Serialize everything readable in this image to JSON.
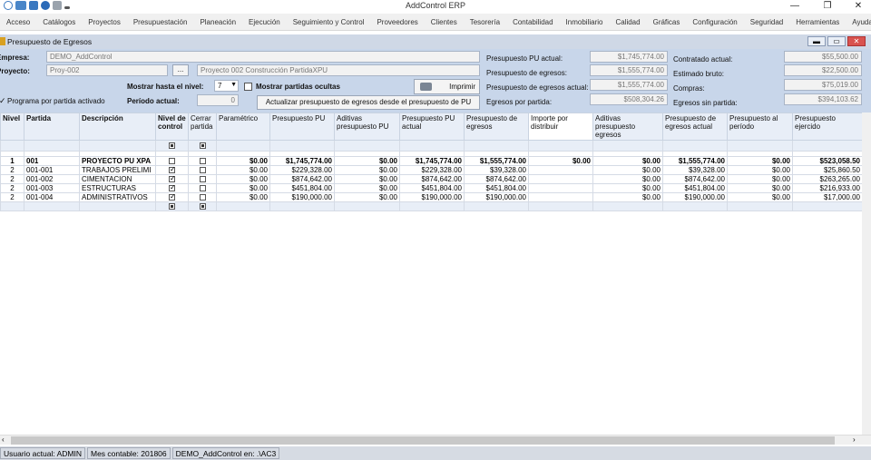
{
  "window": {
    "title": "AddControl ERP",
    "minimize": "—",
    "restore": "❐",
    "close": "✕"
  },
  "menu": [
    "Acceso",
    "Catálogos",
    "Proyectos",
    "Presupuestación",
    "Planeación",
    "Ejecución",
    "Seguimiento y Control",
    "Proveedores",
    "Clientes",
    "Tesorería",
    "Contabilidad",
    "Inmobiliario",
    "Calidad",
    "Gráficas",
    "Configuración",
    "Seguridad",
    "Herramientas",
    "Ayuda"
  ],
  "child": {
    "title": "Presupuesto de Egresos"
  },
  "form": {
    "empresa_label": "Empresa:",
    "empresa_value": "DEMO_AddControl",
    "proyecto_label": "Proyecto:",
    "proyecto_code": "Proy-002",
    "proyecto_browse": "...",
    "proyecto_name": "Proyecto 002 Construcción PartidaXPU",
    "mostrar_nivel_label": "Mostrar hasta el nivel:",
    "nivel_value": "7",
    "mostrar_ocultas_label": "Mostrar partidas ocultas",
    "imprimir_label": "Imprimir",
    "programa_label": "Programa por partida activado",
    "periodo_label": "Período actual:",
    "periodo_value": "0",
    "actualizar_label": "Actualizar presupuesto de egresos desde el presupuesto de PU",
    "pu_actual_label": "Presupuesto PU actual:",
    "pu_actual_value": "$1,745,774.00",
    "egresos_label": "Presupuesto de egresos:",
    "egresos_value": "$1,555,774.00",
    "egresos_actual_label": "Presupuesto de egresos actual:",
    "egresos_actual_value": "$1,555,774.00",
    "egresos_partida_label": "Egresos por partida:",
    "egresos_partida_value": "$508,304.26",
    "contratado_label": "Contratado actual:",
    "contratado_value": "$55,500.00",
    "estimado_label": "Estimado bruto:",
    "estimado_value": "$22,500.00",
    "compras_label": "Compras:",
    "compras_value": "$75,019.00",
    "sin_partida_label": "Egresos sin partida:",
    "sin_partida_value": "$394,103.62"
  },
  "grid": {
    "headers": [
      "Nivel",
      "Partida",
      "Descripción",
      "Nivel de control",
      "Cerrar partida",
      "Paramétrico",
      "Presupuesto PU",
      "Aditivas presupuesto PU",
      "Presupuesto PU actual",
      "Presupuesto de egresos",
      "Importe por distribuir",
      "Aditivas presupuesto egresos",
      "Presupuesto de egresos actual",
      "Presupuesto al período",
      "Presupuesto ejercido"
    ],
    "rows": [
      {
        "nivel": "1",
        "partida": "001",
        "descripcion": "PROYECTO PU XPA",
        "control": false,
        "cerrar": false,
        "parametrico": "$0.00",
        "pu": "$1,745,774.00",
        "aditivas_pu": "$0.00",
        "pu_actual": "$1,745,774.00",
        "egresos": "$1,555,774.00",
        "distribuir": "$0.00",
        "aditivas_egr": "$0.00",
        "egresos_actual": "$1,555,774.00",
        "periodo": "$0.00",
        "ejercido": "$523,058.50"
      },
      {
        "nivel": "2",
        "partida": "001-001",
        "descripcion": "TRABAJOS PRELIMI",
        "control": true,
        "cerrar": false,
        "parametrico": "$0.00",
        "pu": "$229,328.00",
        "aditivas_pu": "$0.00",
        "pu_actual": "$229,328.00",
        "egresos": "$39,328.00",
        "distribuir": "",
        "aditivas_egr": "$0.00",
        "egresos_actual": "$39,328.00",
        "periodo": "$0.00",
        "ejercido": "$25,860.50"
      },
      {
        "nivel": "2",
        "partida": "001-002",
        "descripcion": "CIMENTACION",
        "control": true,
        "cerrar": false,
        "parametrico": "$0.00",
        "pu": "$874,642.00",
        "aditivas_pu": "$0.00",
        "pu_actual": "$874,642.00",
        "egresos": "$874,642.00",
        "distribuir": "",
        "aditivas_egr": "$0.00",
        "egresos_actual": "$874,642.00",
        "periodo": "$0.00",
        "ejercido": "$263,265.00"
      },
      {
        "nivel": "2",
        "partida": "001-003",
        "descripcion": "ESTRUCTURAS",
        "control": true,
        "cerrar": false,
        "parametrico": "$0.00",
        "pu": "$451,804.00",
        "aditivas_pu": "$0.00",
        "pu_actual": "$451,804.00",
        "egresos": "$451,804.00",
        "distribuir": "",
        "aditivas_egr": "$0.00",
        "egresos_actual": "$451,804.00",
        "periodo": "$0.00",
        "ejercido": "$216,933.00"
      },
      {
        "nivel": "2",
        "partida": "001-004",
        "descripcion": "ADMINISTRATIVOS",
        "control": true,
        "cerrar": false,
        "parametrico": "$0.00",
        "pu": "$190,000.00",
        "aditivas_pu": "$0.00",
        "pu_actual": "$190,000.00",
        "egresos": "$190,000.00",
        "distribuir": "",
        "aditivas_egr": "$0.00",
        "egresos_actual": "$190,000.00",
        "periodo": "$0.00",
        "ejercido": "$17,000.00"
      }
    ]
  },
  "status": [
    "Usuario actual: ADMIN",
    "Mes contable: 201806",
    "DEMO_AddControl en: .\\AC3"
  ]
}
